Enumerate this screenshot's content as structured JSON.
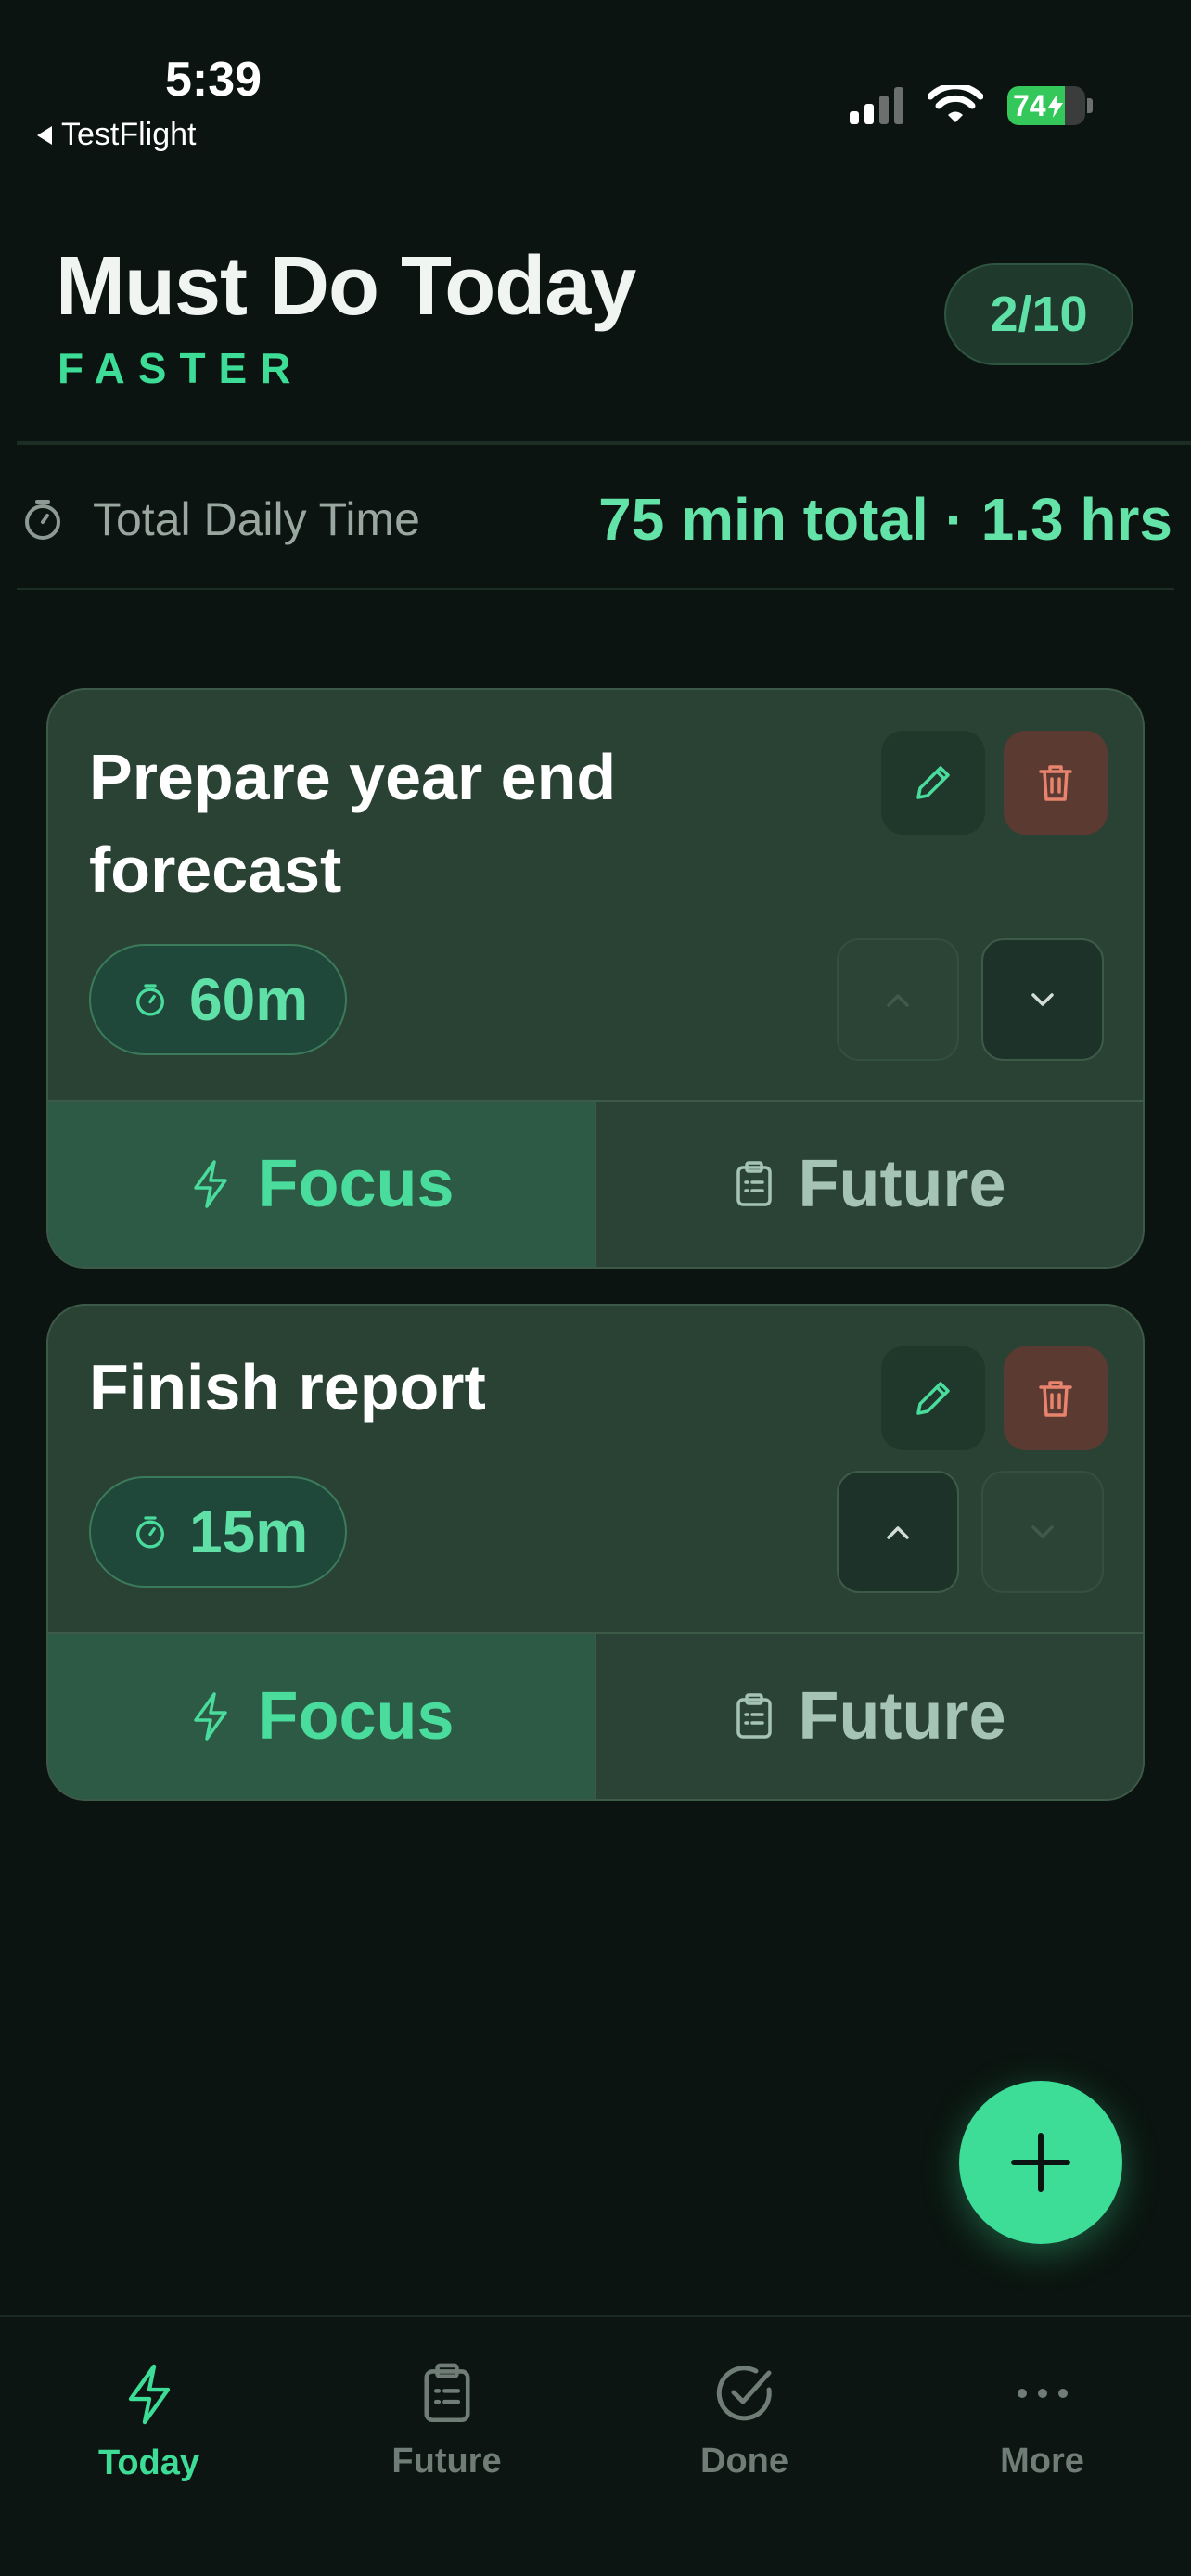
{
  "status_bar": {
    "time": "5:39",
    "back_app": "TestFlight",
    "battery_percent": "74",
    "battery_level": 0.74,
    "icons": [
      "cellular-signal-icon",
      "wifi-icon",
      "battery-charging-icon"
    ]
  },
  "header": {
    "title": "Must Do Today",
    "subtitle": "FASTER",
    "count_badge": "2/10"
  },
  "daily_time": {
    "label": "Total Daily Time",
    "total": "75 min total · 1.3 hrs"
  },
  "tasks": [
    {
      "title": "Prepare year end forecast",
      "duration": "60m",
      "focus_label": "Focus",
      "future_label": "Future",
      "move_up_enabled": false,
      "move_down_enabled": true
    },
    {
      "title": "Finish report",
      "duration": "15m",
      "focus_label": "Focus",
      "future_label": "Future",
      "move_up_enabled": true,
      "move_down_enabled": false
    }
  ],
  "tabs": [
    {
      "label": "Today",
      "icon": "bolt-icon",
      "active": true
    },
    {
      "label": "Future",
      "icon": "clipboard-icon",
      "active": false
    },
    {
      "label": "Done",
      "icon": "check-circle-icon",
      "active": false
    },
    {
      "label": "More",
      "icon": "more-dots-icon",
      "active": false
    }
  ],
  "colors": {
    "accent": "#3ddc97",
    "background": "#0b1410",
    "card": "#2a4234",
    "delete": "#e8836e"
  }
}
